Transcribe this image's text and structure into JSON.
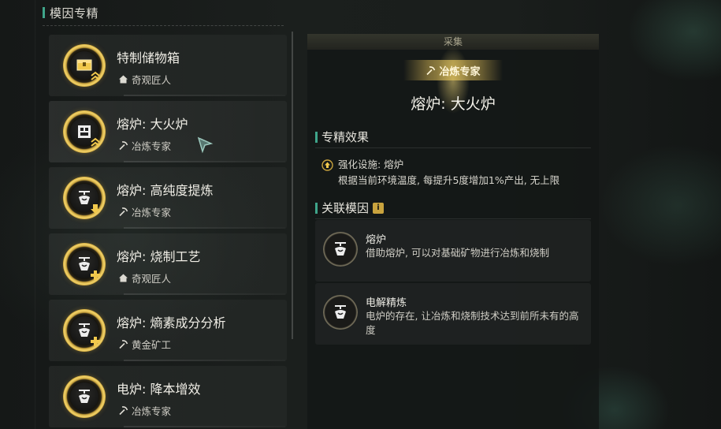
{
  "header": {
    "title": "模因专精"
  },
  "list": [
    {
      "title": "特制储物箱",
      "sub": "奇观匠人",
      "sub_icon": "home-icon",
      "icon": "storage-box-icon",
      "badge": "chevron-icon"
    },
    {
      "title": "熔炉: 大火炉",
      "sub": "冶炼专家",
      "sub_icon": "pickaxe-icon",
      "icon": "furnace-icon",
      "badge": "chevron-icon",
      "selected": true
    },
    {
      "title": "熔炉: 高纯度提炼",
      "sub": "冶炼专家",
      "sub_icon": "pickaxe-icon",
      "icon": "smelter-icon",
      "badge": "arrow-down-icon"
    },
    {
      "title": "熔炉: 烧制工艺",
      "sub": "奇观匠人",
      "sub_icon": "home-icon",
      "icon": "smelter-icon",
      "badge": "plus-icon"
    },
    {
      "title": "熔炉: 熵素成分分析",
      "sub": "黄金矿工",
      "sub_icon": "pickaxe-icon",
      "icon": "smelter-icon",
      "badge": "plus-icon"
    },
    {
      "title": "电炉: 降本增效",
      "sub": "冶炼专家",
      "sub_icon": "pickaxe-icon",
      "icon": "smelter-icon",
      "badge": ""
    }
  ],
  "panel": {
    "category": "采集",
    "spec_tag": "冶炼专家",
    "title": "熔炉: 大火炉",
    "effect_header": "专精效果",
    "effect_line1": "强化设施: 熔炉",
    "effect_line2": "根据当前环境温度, 每提升5度增加1%产出, 无上限",
    "related_header": "关联模因",
    "related": [
      {
        "name": "熔炉",
        "desc": "借助熔炉, 可以对基础矿物进行冶炼和烧制"
      },
      {
        "name": "电解精炼",
        "desc": "电炉的存在, 让冶炼和烧制技术达到前所未有的高度"
      }
    ]
  },
  "colors": {
    "accent": "#3fa58a",
    "gold": "#c9a33e"
  }
}
